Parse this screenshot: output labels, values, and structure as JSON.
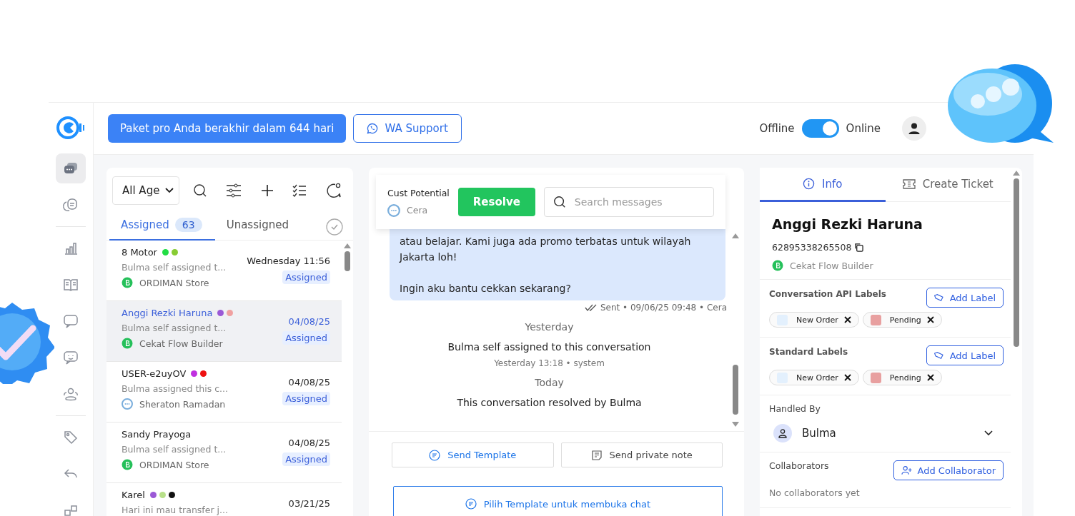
{
  "topbar": {
    "plan_notice": "Paket pro Anda berakhir dalam 644 hari",
    "support_button": "WA Support",
    "status_off_label": "Offline",
    "status_on_label": "Online",
    "online": true
  },
  "sidebar": {
    "items": [
      {
        "kind": "chats",
        "selected": true
      },
      {
        "kind": "notes",
        "selected": false
      },
      {
        "kind": "reports",
        "selected": false
      },
      {
        "kind": "book",
        "selected": false
      },
      {
        "kind": "bubble",
        "selected": false
      },
      {
        "kind": "bot",
        "selected": false
      },
      {
        "kind": "users",
        "selected": false
      },
      {
        "kind": "tag",
        "selected": false
      },
      {
        "kind": "reply",
        "selected": false
      },
      {
        "kind": "grid",
        "selected": false
      }
    ]
  },
  "conversation_list": {
    "filter": "All Age",
    "tabs": [
      {
        "label": "Assigned",
        "count": "63",
        "selected": true
      },
      {
        "label": "Unassigned",
        "selected": false
      }
    ],
    "items": [
      {
        "name": "8 Motor",
        "selected": false,
        "dots": [
          {
            "color": "#22dd44"
          },
          {
            "color": "#88cc33"
          }
        ],
        "preview": "Bulma self assigned t...",
        "channel": {
          "kind": "whatsapp",
          "name": "ORDIMAN Store"
        },
        "date": "Wednesday 11:56",
        "status": "Assigned"
      },
      {
        "name": "Anggi Rezki Haruna",
        "selected": true,
        "dots": [
          {
            "color": "#9b59d6"
          },
          {
            "color": "#f0a0a0"
          }
        ],
        "preview": "Bulma self assigned t...",
        "channel": {
          "kind": "whatsapp",
          "name": "Cekat Flow Builder"
        },
        "date": "04/08/25",
        "status": "Assigned"
      },
      {
        "name": "USER-e2uyOV",
        "selected": false,
        "dots": [
          {
            "color": "#c030e0"
          },
          {
            "color": "#ee1111"
          }
        ],
        "preview": "Bulma assigned this c...",
        "channel": {
          "kind": "livechat",
          "name": "Sheraton Ramadan"
        },
        "date": "04/08/25",
        "status": "Assigned"
      },
      {
        "name": "Sandy Prayoga",
        "selected": false,
        "preview": "Bulma self assigned t...",
        "channel": {
          "kind": "whatsapp",
          "name": "ORDIMAN Store"
        },
        "date": "04/08/25",
        "status": "Assigned"
      },
      {
        "name": "Karel",
        "selected": false,
        "dots": [
          {
            "color": "#9b59d6"
          },
          {
            "color": "#b8e08a"
          },
          {
            "color": "#111111"
          }
        ],
        "preview": "Hari ini mau transfer j...",
        "date": "03/21/25"
      }
    ]
  },
  "chat": {
    "contact_label": "Cust Potential",
    "agent": "Cera",
    "resolve_button": "Resolve",
    "search": {
      "placeholder": "Search messages"
    },
    "message": {
      "paragraphs": [
        {
          "lines": [
            "atau belajar. Kami juga ada promo terbatas untuk wilayah",
            "Jakarta loh!"
          ]
        },
        {
          "lines": [
            "Ingin aku bantu cekkan sekarang?"
          ]
        }
      ],
      "meta": "Sent • 09/06/25 09:48 • Cera"
    },
    "events": [
      {
        "kind": "day",
        "text": "Yesterday"
      },
      {
        "kind": "system",
        "text": "Bulma self assigned to this conversation",
        "meta": "Yesterday 13:18 • system"
      },
      {
        "kind": "day",
        "text": "Today"
      },
      {
        "kind": "system",
        "text": "This conversation resolved by Bulma"
      }
    ],
    "send_template": "Send Template",
    "private_note": "Send private note",
    "open_chat_button": "Pilih Template untuk membuka chat"
  },
  "info": {
    "tabs": [
      {
        "label": "Info",
        "selected": true
      },
      {
        "label": "Create Ticket",
        "selected": false
      }
    ],
    "name": "Anggi Rezki Haruna",
    "phone": "62895338265508",
    "channel": "Cekat Flow Builder",
    "label_groups": [
      {
        "title": "Conversation API Labels",
        "button": "Add Label",
        "labels": [
          {
            "text": "New Order",
            "color": "#e3f0fd"
          },
          {
            "text": "Pending",
            "color": "#e8a0a0"
          }
        ]
      },
      {
        "title": "Standard Labels",
        "button": "Add Label",
        "labels": [
          {
            "text": "New Order",
            "color": "#e3f0fd"
          },
          {
            "text": "Pending",
            "color": "#e8a0a0"
          }
        ]
      }
    ],
    "handled_by_title": "Handled By",
    "handler": "Bulma",
    "collaborators_title": "Collaborators",
    "add_collaborator": "Add Collaborator",
    "no_collaborators": "No collaborators yet"
  }
}
